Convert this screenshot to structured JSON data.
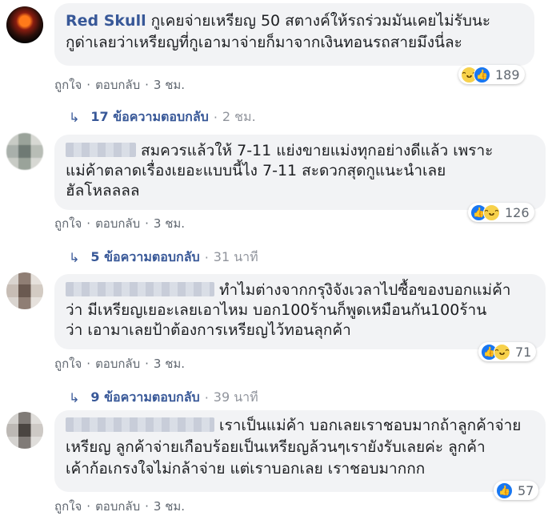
{
  "comments": [
    {
      "author": "Red Skull",
      "text_line1": "กูเคยจ่ายเหรียญ 50 สตางค์ให้รถร่วมมันเคยไม่รับนะ",
      "text_line2": "กูด่าเลยว่าเหรียญที่กูเอามาจ่ายก็มาจากเงินทอนรถสายมึงนี่ละ",
      "like_label": "ถูกใจ",
      "reply_label": "ตอบกลับ",
      "time": "3 ชม.",
      "reaction_count": "189",
      "replies_label": "17 ข้อความตอบกลับ",
      "replies_time": "2 ชม."
    },
    {
      "author_redacted": "P...",
      "text_line1": "สมควรแล้วให้ 7-11 แย่งขายแม่งทุกอย่างดีแล้ว เพราะ",
      "text_line2": "แม่ค้าตลาดเรื่องเยอะแบบนี้ไง 7-11 สะดวกสุดกูแนะนำเลย",
      "text_line3": "ฮัลโหลลลล",
      "like_label": "ถูกใจ",
      "reply_label": "ตอบกลับ",
      "time": "3 ชม.",
      "reaction_count": "126",
      "replies_label": "5 ข้อความตอบกลับ",
      "replies_time": "31 นาที"
    },
    {
      "text_line1": "ทำไมต่างจากกรุงิจังเวลาไปซื้อของบอกแม่ค้า",
      "text_line2": "ว่า มีเหรียญเยอะเลยเอาไหม บอก100ร้านก็พูดเหมือนกัน100ร้าน",
      "text_line3": "ว่า เอามาเลยป้าต้องการเหรียญไว้ทอนลุกค้า",
      "like_label": "ถูกใจ",
      "reply_label": "ตอบกลับ",
      "time": "3 ชม.",
      "reaction_count": "71",
      "replies_label": "9 ข้อความตอบกลับ",
      "replies_time": "39 นาที"
    },
    {
      "text_line1": "เราเป็นแม่ค้า บอกเลยเราชอบมากถ้าลูกค้าจ่าย",
      "text_line2": "เหรียญ ลูกค้าจ่ายเกือบร้อยเป็นเหรียญล้วนๆเรายังรับเลยค่ะ ลูกค้า",
      "text_line3": "เค้าก้อเกรงใจไม่กล้าจ่าย แต่เราบอกเลย เราชอบมากกก",
      "like_label": "ถูกใจ",
      "reply_label": "ตอบกลับ",
      "time": "3 ชม.",
      "reaction_count": "57"
    }
  ],
  "separator": "·",
  "reply_arrow_glyph": "↳",
  "colors": {
    "link_blue": "#385898",
    "bubble_bg": "#f2f3f5",
    "like_blue": "#1877f2",
    "haha_yellow": "#f7d14b",
    "meta_gray": "#606770"
  }
}
